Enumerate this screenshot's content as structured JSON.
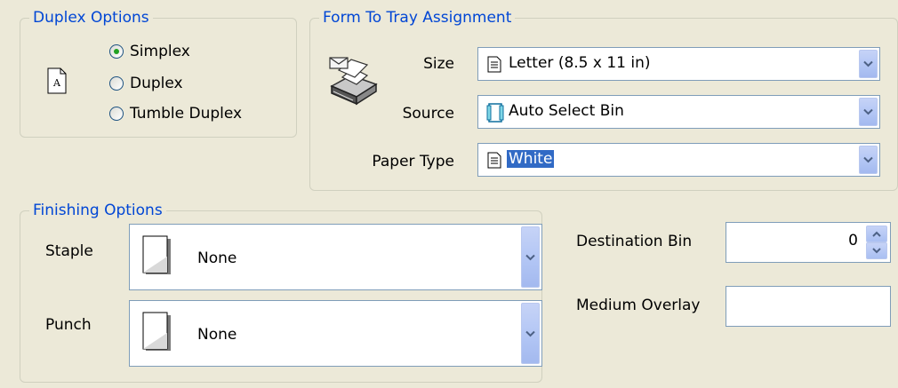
{
  "duplex": {
    "legend": "Duplex Options",
    "options": [
      "Simplex",
      "Duplex",
      "Tumble Duplex"
    ],
    "selected": "Simplex",
    "preview_letter": "A"
  },
  "form_tray": {
    "legend": "Form To Tray Assignment",
    "size_label": "Size",
    "size_value": "Letter (8.5 x 11 in)",
    "source_label": "Source",
    "source_value": "Auto Select Bin",
    "paper_type_label": "Paper Type",
    "paper_type_value": "White"
  },
  "finishing": {
    "legend": "Finishing Options",
    "staple_label": "Staple",
    "staple_value": "None",
    "punch_label": "Punch",
    "punch_value": "None"
  },
  "destination_bin": {
    "label": "Destination Bin",
    "value": "0"
  },
  "medium_overlay": {
    "label": "Medium Overlay",
    "value": ""
  },
  "colors": {
    "background": "#ece9d8",
    "legend_text": "#0046d5",
    "selection": "#316ac5",
    "field_border": "#7f9db9"
  },
  "icons": [
    "document-a-icon",
    "printer-envelope-icon",
    "document-icon",
    "bin-icon",
    "chevron-down-icon",
    "spin-up-icon",
    "spin-down-icon",
    "page-fold-icon"
  ]
}
